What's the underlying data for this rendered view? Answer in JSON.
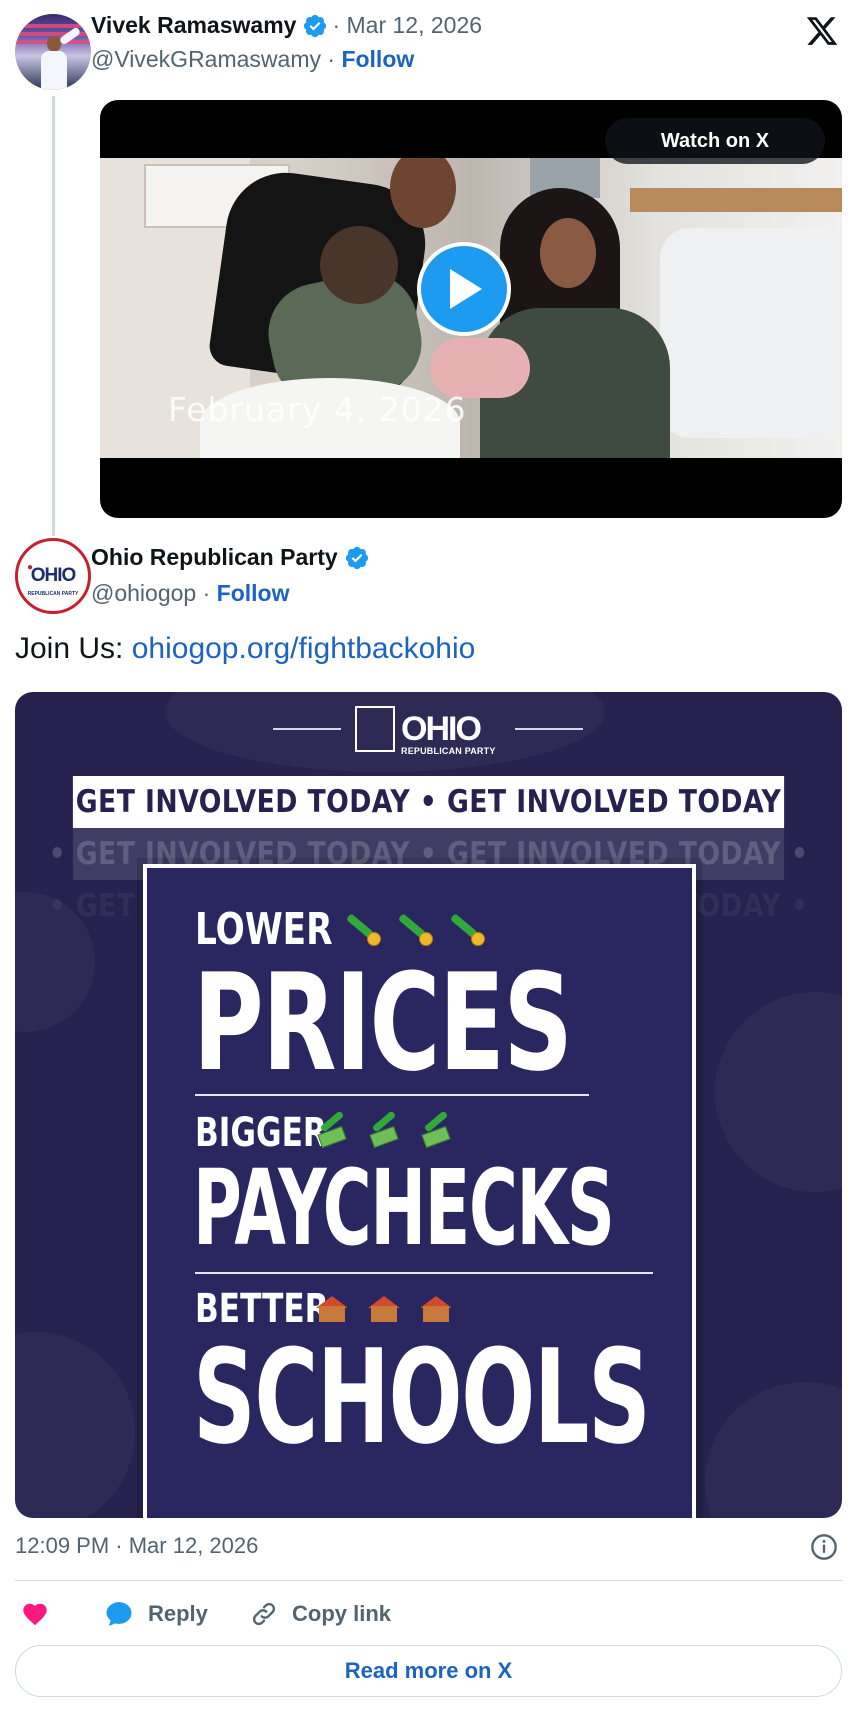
{
  "colors": {
    "link": "#1d63c1",
    "verified": "#1d9bf0",
    "like": "#f91880",
    "text_secondary": "#536471",
    "poster_bg": "#26214f"
  },
  "parent_tweet": {
    "author_name": "Vivek Ramaswamy",
    "verified_icon": "verified-badge-icon",
    "separator_date": "· Mar 12, 2026",
    "handle": "@VivekGRamaswamy",
    "handle_sep": " · ",
    "follow_label": "Follow",
    "video": {
      "watch_label": "Watch on X",
      "overlay_date": "February 4, 2026",
      "play_icon": "play-icon"
    }
  },
  "main_tweet": {
    "author_name": "Ohio Republican Party",
    "avatar_logo_text": "OHIO",
    "avatar_logo_sub": "REPUBLICAN PARTY",
    "handle": "@ohiogop",
    "handle_sep": " · ",
    "follow_label": "Follow",
    "text_prefix": "Join Us: ",
    "text_link": "ohiogop.org/fightbackohio",
    "poster": {
      "logo_word": "OHIO",
      "logo_sub": "REPUBLICAN PARTY",
      "banner_text": "• GET INVOLVED TODAY • GET INVOLVED TODAY •",
      "line1_small": "LOWER",
      "line1_big": "PRICES",
      "line2_small": "BIGGER",
      "line2_big": "PAYCHECKS",
      "line3_small": "BETTER",
      "line3_big": "SCHOOLS"
    },
    "timestamp": "12:09 PM · Mar 12, 2026"
  },
  "actions": {
    "like_icon": "heart-icon",
    "reply_label": "Reply",
    "copy_label": "Copy link",
    "read_more_label": "Read more on X"
  }
}
